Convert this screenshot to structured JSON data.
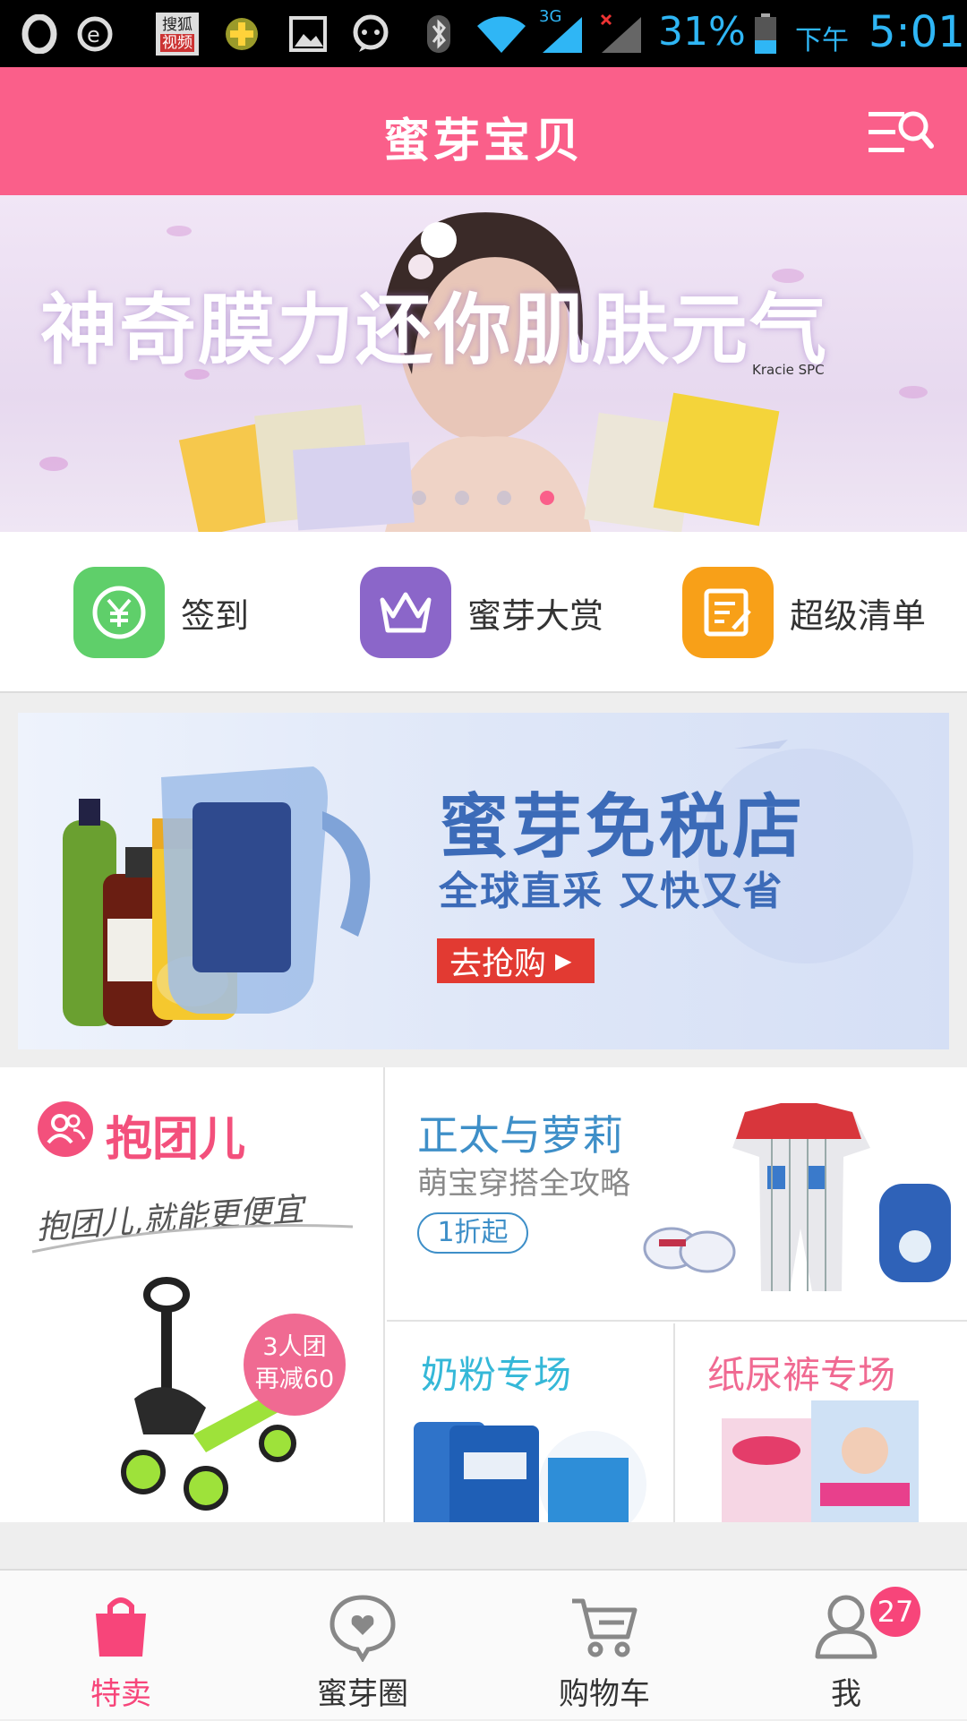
{
  "status_bar": {
    "battery_percent": "31%",
    "ampm": "下午",
    "time": "5:01",
    "network": "3G",
    "sohu_label_1": "搜狐",
    "sohu_label_2": "视频"
  },
  "header": {
    "title": "蜜芽宝贝"
  },
  "banner": {
    "headline": "神奇膜力还你肌肤元气",
    "brand_text": "Kracie SPC",
    "dot_count": 4,
    "active_dot": 4
  },
  "quick_menu": [
    {
      "label": "签到",
      "icon": "yen-coin-icon",
      "color": "#5fcf6a"
    },
    {
      "label": "蜜芽大赏",
      "icon": "crown-icon",
      "color": "#8b66c9"
    },
    {
      "label": "超级清单",
      "icon": "checklist-icon",
      "color": "#f8a018"
    }
  ],
  "duty_free": {
    "title": "蜜芽免税店",
    "subtitle": "全球直采 又快又省",
    "button": "去抢购"
  },
  "group_buy": {
    "title": "抱团儿",
    "slogan": "抱团儿,就能更便宜",
    "badge_line1": "3人团",
    "badge_line2": "再减60"
  },
  "outfit": {
    "title": "正太与萝莉",
    "subtitle": "萌宝穿搭全攻略",
    "tag": "1折起"
  },
  "milk": {
    "title": "奶粉专场"
  },
  "diaper": {
    "title": "纸尿裤专场"
  },
  "tabs": [
    {
      "label": "特卖",
      "icon": "shopping-bag-icon",
      "active": true
    },
    {
      "label": "蜜芽圈",
      "icon": "heart-bubble-icon",
      "active": false
    },
    {
      "label": "购物车",
      "icon": "cart-icon",
      "active": false
    },
    {
      "label": "我",
      "icon": "user-icon",
      "active": false
    }
  ],
  "me_badge": "27",
  "colors": {
    "brand_pink": "#fa5f8a",
    "tab_active": "#f7457a",
    "duty_blue": "#3c6bb8"
  }
}
